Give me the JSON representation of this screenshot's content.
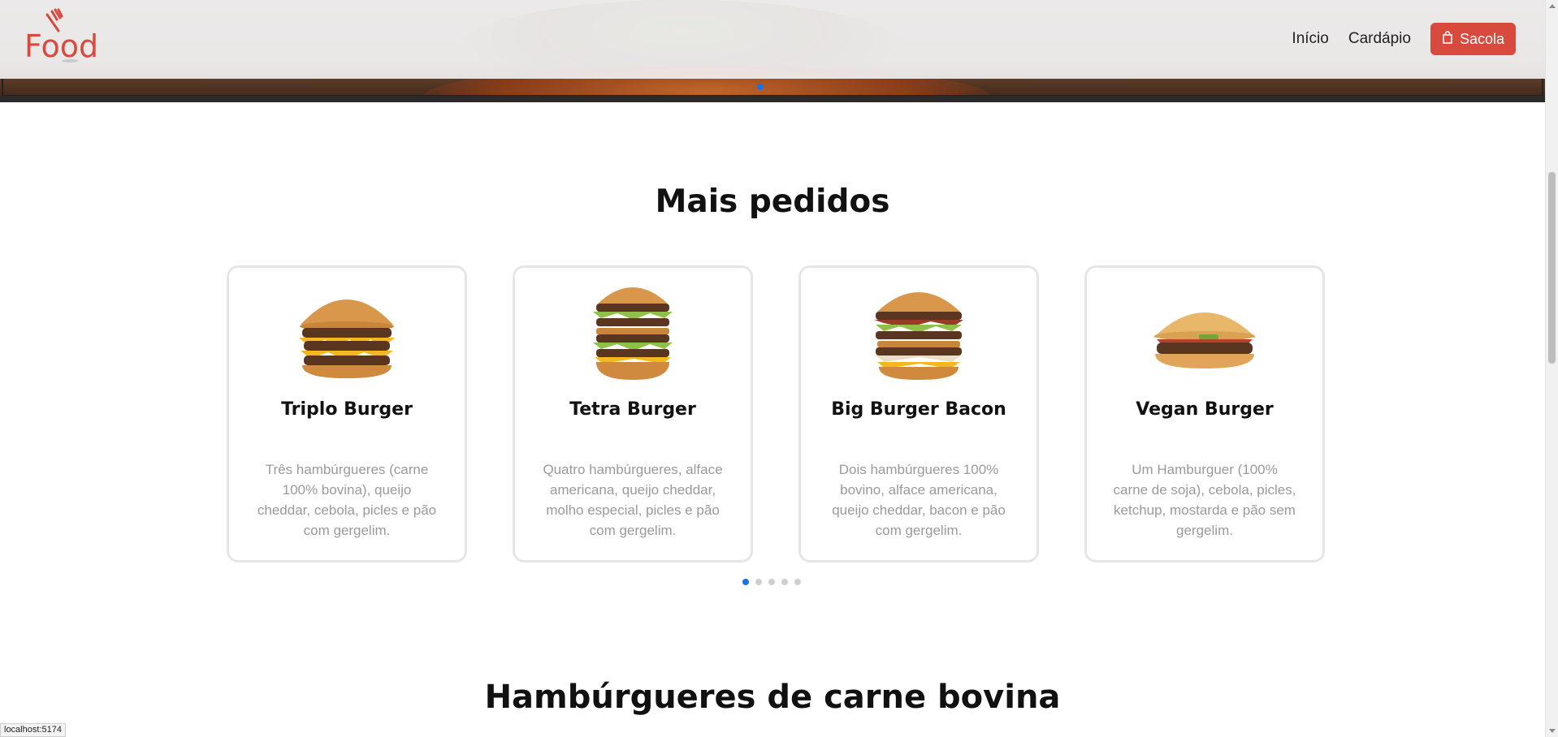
{
  "brand": {
    "logo_text": "Food",
    "accent": "#d84a3d"
  },
  "nav": {
    "links": [
      "Início",
      "Cardápio"
    ],
    "bag_label": "Sacola"
  },
  "sections": {
    "most_ordered_title": "Mais pedidos",
    "beef_title": "Hambúrgueres de carne bovina"
  },
  "products": [
    {
      "name": "Triplo Burger",
      "description": "Três hambúrgueres (carne 100% bovina), queijo cheddar, cebola, picles e pão com gergelim."
    },
    {
      "name": "Tetra Burger",
      "description": "Quatro hambúrgueres, alface americana, queijo cheddar, molho especial, picles e pão com gergelim."
    },
    {
      "name": "Big Burger Bacon",
      "description": "Dois hambúrgueres 100% bovino, alface americana, queijo cheddar, bacon e pão com gergelim."
    },
    {
      "name": "Vegan Burger",
      "description": "Um Hamburguer (100% carne de soja), cebola, picles, ketchup, mostarda e pão sem gergelim."
    }
  ],
  "carousel": {
    "pages": 5,
    "active": 1
  },
  "status_bar": "localhost:5174"
}
